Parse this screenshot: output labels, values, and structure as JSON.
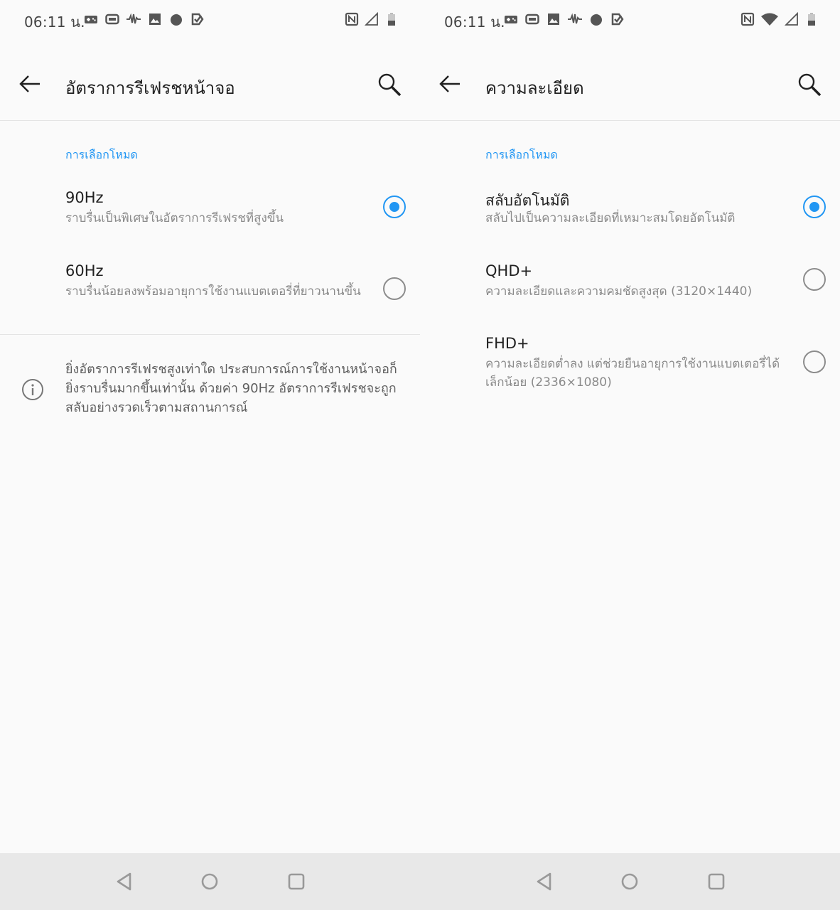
{
  "status_bar": {
    "time": "06:11 น.",
    "left_icons": [
      "gamepad-icon",
      "screen-record-icon",
      "waveform-icon",
      "image-icon",
      "firefox-icon",
      "checkmark-app-icon"
    ],
    "right_icons_left_screen": [
      "nfc-icon",
      "signal-icon",
      "battery-icon"
    ],
    "right_icons_right_screen": [
      "nfc-icon",
      "wifi-icon",
      "signal-icon",
      "battery-icon"
    ]
  },
  "refresh_rate_screen": {
    "title": "อัตราการรีเฟรชหน้าจอ",
    "section_header": "การเลือกโหมด",
    "options": [
      {
        "title": "90Hz",
        "description": "ราบรื่นเป็นพิเศษในอัตราการรีเฟรชที่สูงขึ้น",
        "selected": true
      },
      {
        "title": "60Hz",
        "description": "ราบรื่นน้อยลงพร้อมอายุการใช้งานแบตเตอรี่ที่ยาวนานขึ้น",
        "selected": false
      }
    ],
    "info_text": "ยิ่งอัตราการรีเฟรชสูงเท่าใด ประสบการณ์การใช้งานหน้าจอก็ยิ่งราบรื่นมากขึ้นเท่านั้น ด้วยค่า 90Hz อัตราการรีเฟรชจะถูกสลับอย่างรวดเร็วตามสถานการณ์"
  },
  "resolution_screen": {
    "title": "ความละเอียด",
    "section_header": "การเลือกโหมด",
    "options": [
      {
        "title": "สลับอัตโนมัติ",
        "description": "สลับไปเป็นความละเอียดที่เหมาะสมโดยอัตโนมัติ",
        "selected": true
      },
      {
        "title": "QHD+",
        "description": "ความละเอียดและความคมชัดสูงสุด (3120×1440)",
        "selected": false
      },
      {
        "title": "FHD+",
        "description": "ความละเอียดต่ำลง แต่ช่วยยืนอายุการใช้งานแบตเตอรี่ได้เล็กน้อย (2336×1080)",
        "selected": false
      }
    ]
  },
  "colors": {
    "accent": "#2196f3",
    "background": "#fafafa",
    "nav_bar": "#e8e8e8",
    "secondary_text": "#8a8a8a"
  }
}
